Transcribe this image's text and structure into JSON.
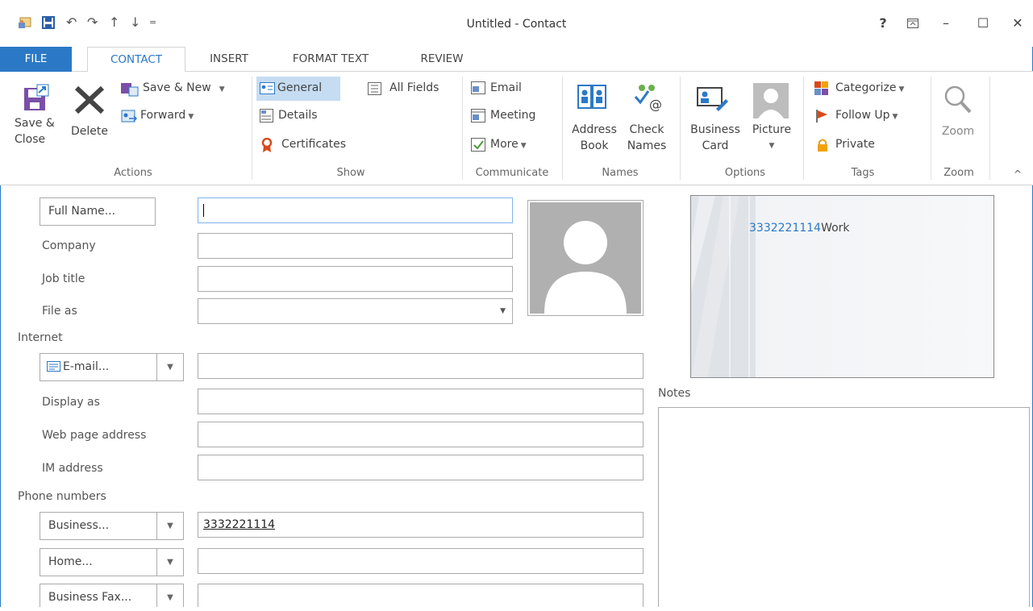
{
  "window": {
    "title": "Untitled - Contact",
    "help": "?",
    "restore_ribbon": "⊼",
    "minimize": "–",
    "maximize": "☐",
    "close": "✕"
  },
  "qat": {
    "app_icon": "contact-card-icon",
    "save": "save-icon",
    "undo": "↶",
    "redo": "↷",
    "up": "↑",
    "down": "↓",
    "customize": "="
  },
  "tabs": [
    "FILE",
    "CONTACT",
    "INSERT",
    "FORMAT TEXT",
    "REVIEW"
  ],
  "ribbon": {
    "actions": {
      "save_close": [
        "Save &",
        "Close"
      ],
      "delete": "Delete",
      "save_new": "Save & New",
      "forward": "Forward",
      "label": "Actions"
    },
    "show": {
      "general": "General",
      "all_fields": "All Fields",
      "details": "Details",
      "certificates": "Certificates",
      "label": "Show"
    },
    "communicate": {
      "email": "Email",
      "meeting": "Meeting",
      "more": "More",
      "label": "Communicate"
    },
    "names": {
      "address_book": [
        "Address",
        "Book"
      ],
      "check_names": [
        "Check",
        "Names"
      ],
      "label": "Names"
    },
    "options": {
      "business_card": [
        "Business",
        "Card"
      ],
      "picture": "Picture",
      "label": "Options"
    },
    "tags": {
      "categorize": "Categorize",
      "follow_up": "Follow Up",
      "private": "Private",
      "label": "Tags"
    },
    "zoom": {
      "zoom": "Zoom",
      "label": "Zoom"
    },
    "collapse": "^"
  },
  "form": {
    "full_name_button": "Full Name...",
    "company_label": "Company",
    "job_title_label": "Job title",
    "file_as_label": "File as",
    "internet_section": "Internet",
    "email_button": "E-mail...",
    "display_as_label": "Display as",
    "web_page_label": "Web page address",
    "im_label": "IM address",
    "phone_section": "Phone numbers",
    "business_button": "Business...",
    "business_value": "3332221114",
    "home_button": "Home...",
    "business_fax_button": "Business Fax...",
    "notes_label": "Notes"
  },
  "business_card": {
    "phone": "3332221114",
    "phone_type": "Work"
  },
  "colors": {
    "accent": "#2b79c6",
    "link": "#2b79c6"
  }
}
